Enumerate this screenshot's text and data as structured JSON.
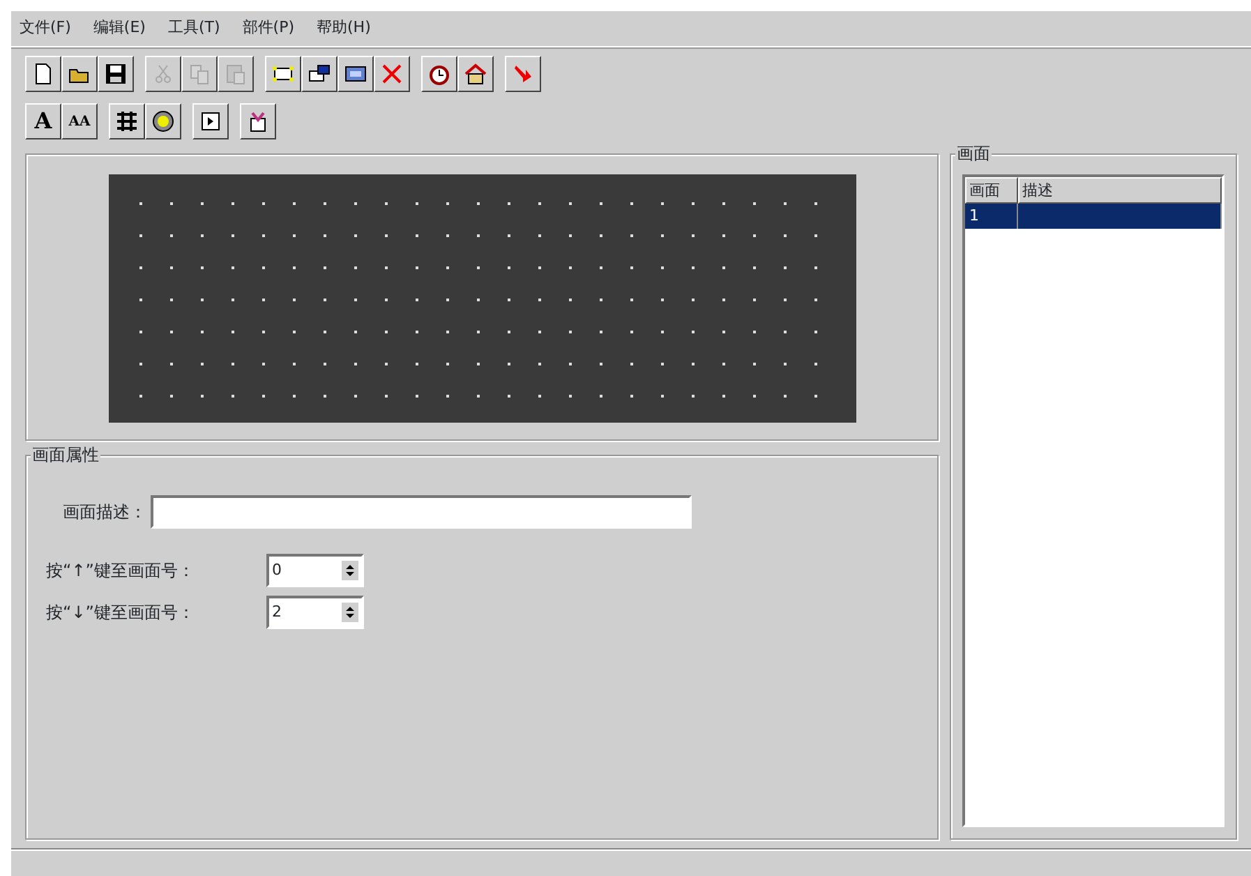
{
  "menu": [
    "文件(F)",
    "编辑(E)",
    "工具(T)",
    "部件(P)",
    "帮助(H)"
  ],
  "toolbars": [
    [
      [
        {
          "disabled": false
        },
        {
          "disabled": false
        },
        {
          "disabled": false
        }
      ],
      [
        {
          "disabled": true
        },
        {
          "disabled": true
        },
        {
          "disabled": true
        }
      ],
      [
        {
          "disabled": false
        },
        {
          "disabled": false
        },
        {
          "disabled": false
        },
        {
          "disabled": false
        }
      ],
      [
        {
          "disabled": false
        },
        {
          "disabled": false
        }
      ],
      [
        {
          "disabled": false
        }
      ]
    ],
    [
      [
        {
          "disabled": false,
          "label": "A"
        },
        {
          "disabled": false,
          "label": "AA"
        }
      ],
      [
        {
          "disabled": false
        },
        {
          "disabled": false
        }
      ],
      [
        {
          "disabled": false
        }
      ],
      [
        {
          "disabled": false
        }
      ]
    ]
  ],
  "properties": {
    "title": "画面属性",
    "description_label": "画面描述：",
    "spinners": [
      {
        "label": "按“↑”键至画面号：",
        "value": "0"
      },
      {
        "label": "按“↓”键至画面号：",
        "value": "2"
      }
    ]
  },
  "screens": {
    "title": "画面",
    "columns": [
      "画面",
      "描述"
    ],
    "rows": [
      {
        "cells": [
          "1",
          ""
        ],
        "selected": true
      }
    ]
  }
}
